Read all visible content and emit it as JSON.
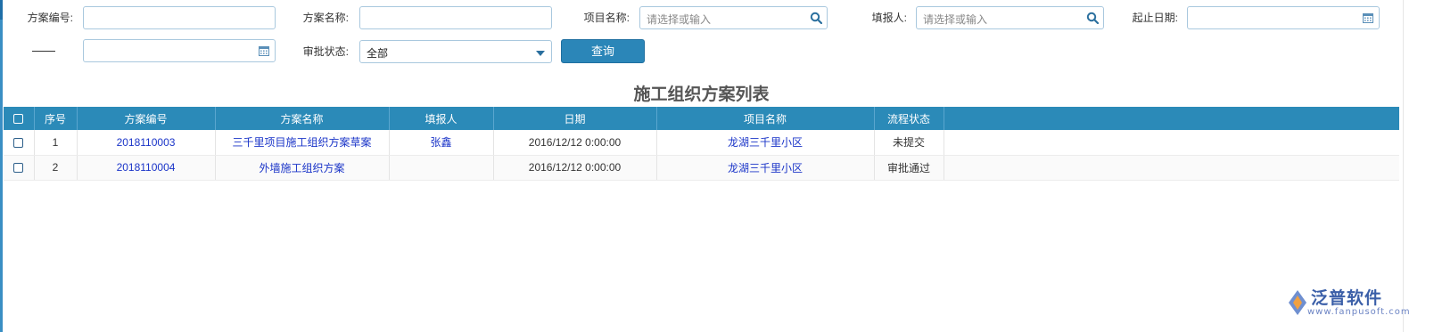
{
  "filters": {
    "plan_no_label": "方案编号:",
    "plan_name_label": "方案名称:",
    "project_name_label": "项目名称:",
    "project_name_placeholder": "请选择或输入",
    "reporter_label": "填报人:",
    "reporter_placeholder": "请选择或输入",
    "start_date_label": "起止日期:",
    "approval_status_label": "审批状态:",
    "approval_status_value": "全部",
    "query_button": "查询"
  },
  "list": {
    "title": "施工组织方案列表",
    "columns": [
      "序号",
      "方案编号",
      "方案名称",
      "填报人",
      "日期",
      "项目名称",
      "流程状态"
    ],
    "rows": [
      {
        "seq": "1",
        "plan_no": "2018110003",
        "plan_name": "三千里项目施工组织方案草案",
        "reporter": "张鑫",
        "date": "2016/12/12 0:00:00",
        "project": "龙湖三千里小区",
        "status": "未提交"
      },
      {
        "seq": "2",
        "plan_no": "2018110004",
        "plan_name": "外墙施工组织方案",
        "reporter": "",
        "date": "2016/12/12 0:00:00",
        "project": "龙湖三千里小区",
        "status": "审批通过"
      }
    ]
  },
  "watermark": {
    "brand": "泛普软件",
    "url": "www.fanpusoft.com"
  },
  "colors": {
    "header_bg": "#2b8ab8",
    "link": "#1a34c8",
    "button_bg": "#2b86b8"
  }
}
